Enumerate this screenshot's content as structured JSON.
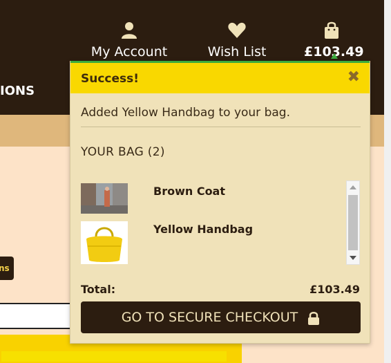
{
  "header": {
    "menu_partial": "IONS",
    "account_label": "My Account",
    "wishlist_label": "Wish List",
    "bag_total": "£103.49"
  },
  "page": {
    "partial_button_text": "ns"
  },
  "dropdown": {
    "success_title": "Success!",
    "close_symbol": "✖",
    "added_message": "Added Yellow Handbag to your bag.",
    "bag_heading": "YOUR BAG (2)",
    "items": [
      {
        "name": "Brown Coat",
        "image": "coat-photo"
      },
      {
        "name": "Yellow Handbag",
        "image": "handbag-photo"
      }
    ],
    "total_label": "Total:",
    "total_value": "£103.49",
    "checkout_label": "GO TO SECURE CHECKOUT"
  },
  "colors": {
    "header_bg": "#2c1d10",
    "accent_yellow": "#f9d800",
    "panel_bg": "#f0e2b9",
    "success_line": "#3bab3e"
  }
}
